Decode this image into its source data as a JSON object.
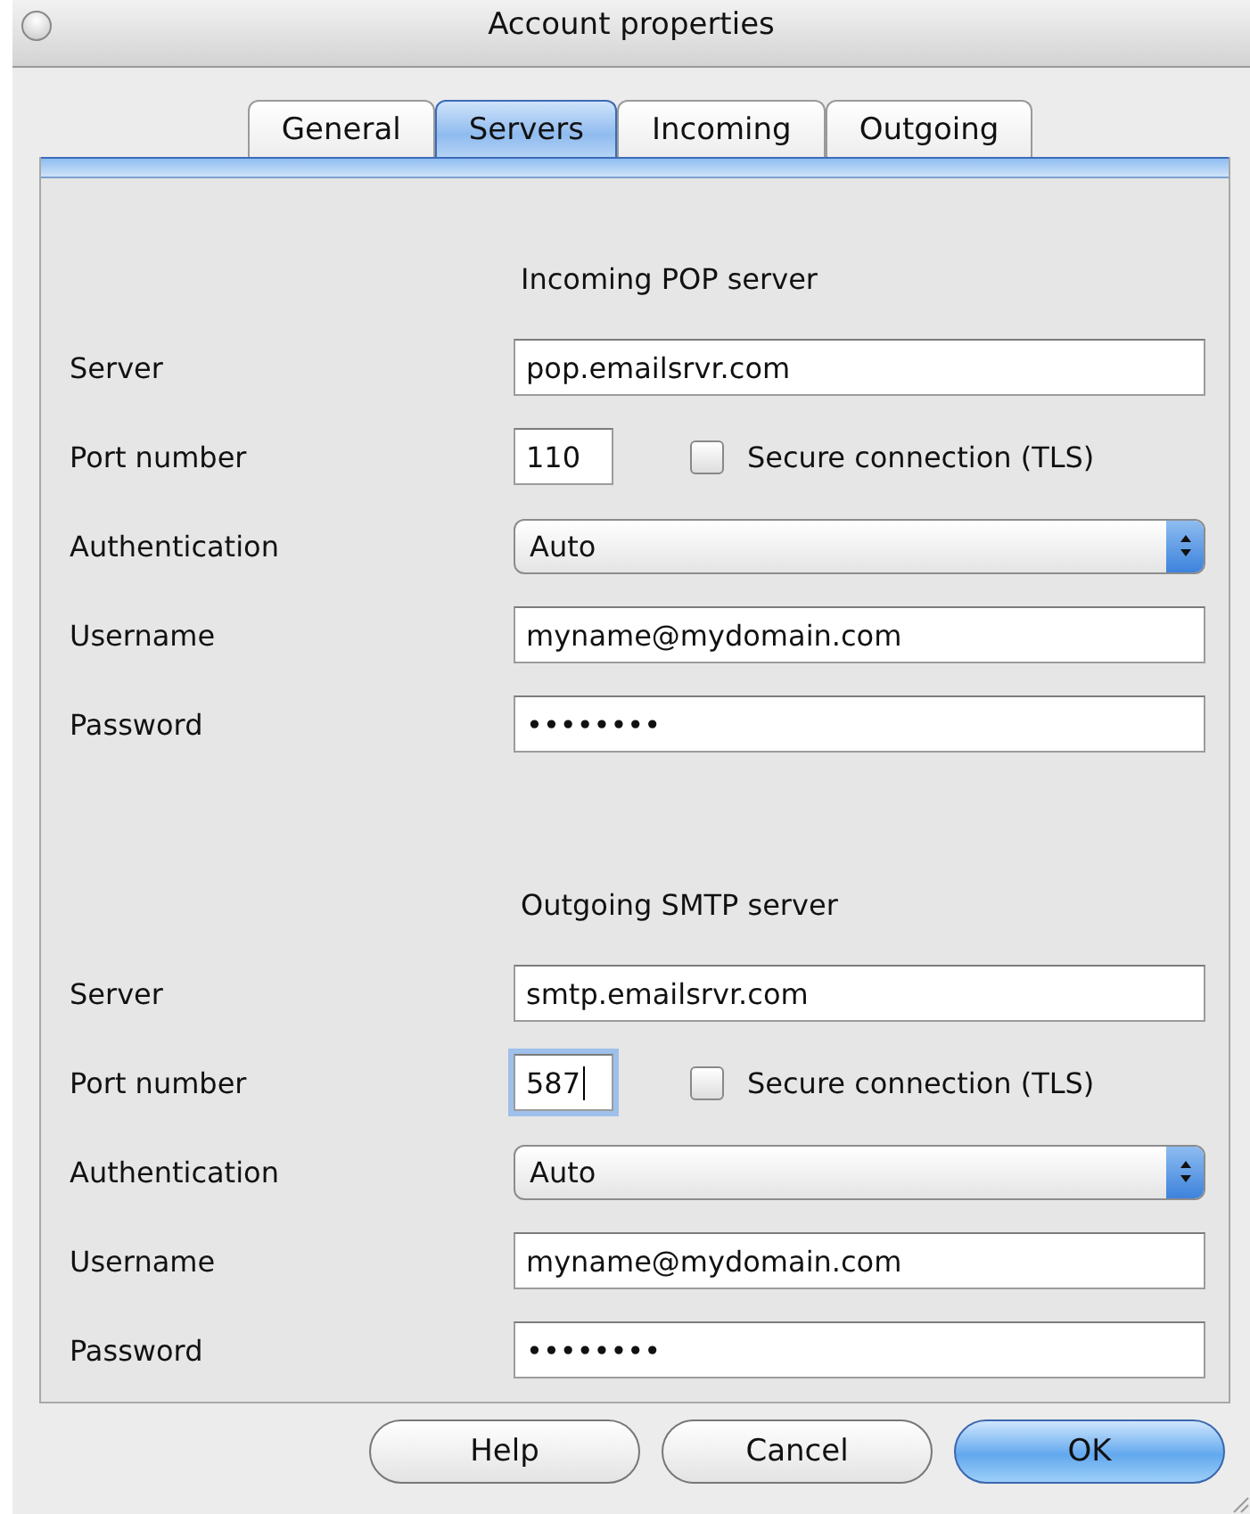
{
  "window": {
    "title": "Account properties"
  },
  "tabs": [
    {
      "label": "General",
      "selected": false
    },
    {
      "label": "Servers",
      "selected": true
    },
    {
      "label": "Incoming",
      "selected": false
    },
    {
      "label": "Outgoing",
      "selected": false
    }
  ],
  "sections": [
    {
      "heading": "Incoming POP server",
      "rows": [
        {
          "kind": "text",
          "label": "Server",
          "value": "pop.emailsrvr.com"
        },
        {
          "kind": "port",
          "label": "Port number",
          "value": "110",
          "focused": false,
          "checkbox": {
            "label": "Secure connection (TLS)",
            "checked": false
          }
        },
        {
          "kind": "select",
          "label": "Authentication",
          "value": "Auto"
        },
        {
          "kind": "text",
          "label": "Username",
          "value": "myname@mydomain.com"
        },
        {
          "kind": "password",
          "label": "Password",
          "value": "••••••••"
        }
      ]
    },
    {
      "heading": "Outgoing SMTP server",
      "rows": [
        {
          "kind": "text",
          "label": "Server",
          "value": "smtp.emailsrvr.com"
        },
        {
          "kind": "port",
          "label": "Port number",
          "value": "587",
          "focused": true,
          "checkbox": {
            "label": "Secure connection (TLS)",
            "checked": false
          }
        },
        {
          "kind": "select",
          "label": "Authentication",
          "value": "Auto"
        },
        {
          "kind": "text",
          "label": "Username",
          "value": "myname@mydomain.com"
        },
        {
          "kind": "password",
          "label": "Password",
          "value": "••••••••"
        }
      ]
    }
  ],
  "buttons": [
    {
      "label": "Help",
      "default": false
    },
    {
      "label": "Cancel",
      "default": false
    },
    {
      "label": "OK",
      "default": true
    }
  ]
}
